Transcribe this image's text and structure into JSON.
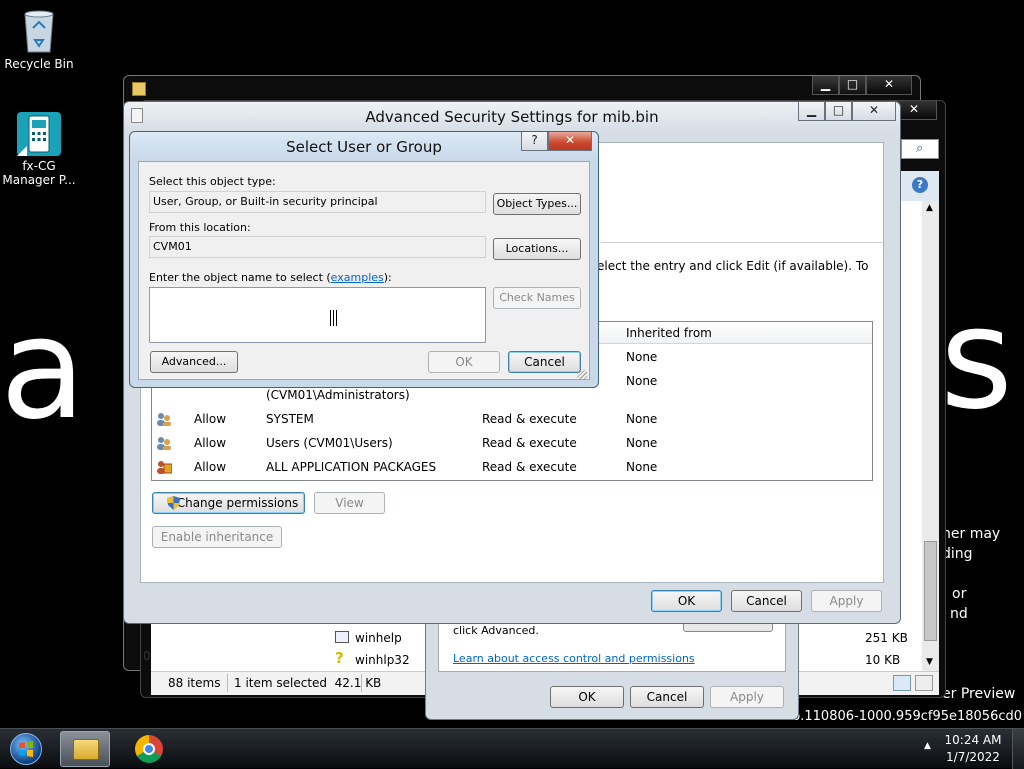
{
  "desktop": {
    "wallpaper_words": [
      "a",
      "s"
    ],
    "icons": [
      {
        "label": "Recycle Bin",
        "icon": "recycle-bin-icon"
      },
      {
        "label": "fx-CG Manager P...",
        "icon": "calculator-app-icon"
      }
    ],
    "watermark": {
      "line1": "ner may",
      "line2": "ding",
      "line3": "or",
      "line4": "nd",
      "build_edition": "er Preview",
      "build_string": "b.110806-1000.959cf95e18056cd0"
    }
  },
  "back_window": {
    "title": ""
  },
  "explorer": {
    "files": [
      {
        "name": "winhelp",
        "size": "251 KB"
      },
      {
        "name": "winhlp32",
        "size": "10 KB"
      }
    ],
    "status_items": "88 items",
    "status_selected": "1 item selected  42.1 KB",
    "left_zero": "0"
  },
  "properties": {
    "advanced_hint": "click Advanced.",
    "learn_link": "Learn about access control and permissions",
    "ok": "OK",
    "cancel": "Cancel",
    "apply": "Apply"
  },
  "adv": {
    "title": "Advanced Security Settings for mib.bin",
    "instructions": "elect the entry and click Edit (if available). To",
    "column_inherited": "Inherited from",
    "hidden_rows": [
      {
        "inherited": "None"
      },
      {
        "inherited": "None",
        "principal_line2": "(CVM01\\Administrators)"
      }
    ],
    "entries": [
      {
        "type": "Allow",
        "principal": "SYSTEM",
        "access": "Read & execute",
        "inherited": "None"
      },
      {
        "type": "Allow",
        "principal": "Users (CVM01\\Users)",
        "access": "Read & execute",
        "inherited": "None"
      },
      {
        "type": "Allow",
        "principal": "ALL APPLICATION PACKAGES",
        "access": "Read & execute",
        "inherited": "None"
      }
    ],
    "change_permissions": "Change permissions",
    "view": "View",
    "enable_inheritance": "Enable inheritance",
    "ok": "OK",
    "cancel": "Cancel",
    "apply": "Apply"
  },
  "dialog": {
    "title": "Select User or Group",
    "help": "?",
    "object_type_label": "Select this object type:",
    "object_type_value": "User, Group, or Built-in security principal",
    "object_types_btn": "Object Types...",
    "location_label": "From this location:",
    "location_value": "CVM01",
    "locations_btn": "Locations...",
    "name_label_pre": "Enter the object name to select (",
    "name_label_link": "examples",
    "name_label_post": "):",
    "name_value": "",
    "check_names_btn": "Check Names",
    "advanced_btn": "Advanced...",
    "ok_btn": "OK",
    "cancel_btn": "Cancel"
  },
  "taskbar": {
    "time": "10:24 AM",
    "date": "1/7/2022",
    "tray_arrow": "▲"
  }
}
